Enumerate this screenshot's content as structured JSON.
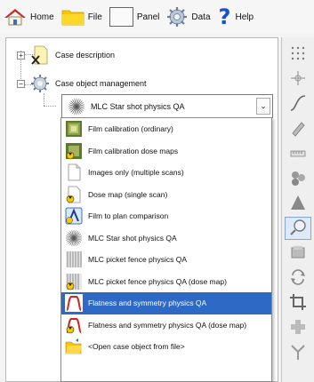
{
  "toolbar": {
    "home_label": "Home",
    "file_label": "File",
    "panel_label": "Panel",
    "data_label": "Data",
    "help_label": "Help",
    "help_glyph": "?"
  },
  "tree": {
    "case_description": "Case description",
    "case_object_management": "Case object management",
    "expand_symbol": "+",
    "collapse_symbol": "−"
  },
  "combo": {
    "selected": "MLC Star shot physics QA",
    "arrow": "⌄"
  },
  "dropdown": {
    "items": [
      {
        "label": "Film calibration (ordinary)",
        "icon": "film-calibration-icon"
      },
      {
        "label": "Film calibration dose maps",
        "icon": "film-calibration-dose-icon"
      },
      {
        "label": "Images only (multiple scans)",
        "icon": "document-icon"
      },
      {
        "label": "Dose map (single scan)",
        "icon": "dose-map-icon"
      },
      {
        "label": "Film to plan comparison",
        "icon": "comparison-icon"
      },
      {
        "label": "MLC Star shot physics QA",
        "icon": "starburst-icon"
      },
      {
        "label": "MLC picket fence physics QA",
        "icon": "picket-fence-icon"
      },
      {
        "label": "MLC picket fence physics QA (dose map)",
        "icon": "picket-fence-dose-icon"
      },
      {
        "label": "Flatness and symmetry physics QA",
        "icon": "profile-icon"
      },
      {
        "label": "Flatness and symmetry physics QA (dose map)",
        "icon": "profile-dose-icon"
      },
      {
        "label": "<Open case object from file>",
        "icon": "open-folder-icon"
      }
    ],
    "selected_index": 8
  },
  "palette": {
    "tools": [
      "grid-dots-icon",
      "crosshair-icon",
      "curve-icon",
      "pen-icon",
      "ruler-icon",
      "circles-icon",
      "triangle-icon",
      "magnifier-icon",
      "layers-icon",
      "arrows-cycle-icon",
      "crop-icon",
      "plus-icon",
      "fork-icon"
    ],
    "active_index": 7
  },
  "colors": {
    "selection": "#2f69c6",
    "help_blue": "#1a4fd0",
    "folder_yellow": "#f7c600",
    "home_red": "#cc2a1d"
  }
}
